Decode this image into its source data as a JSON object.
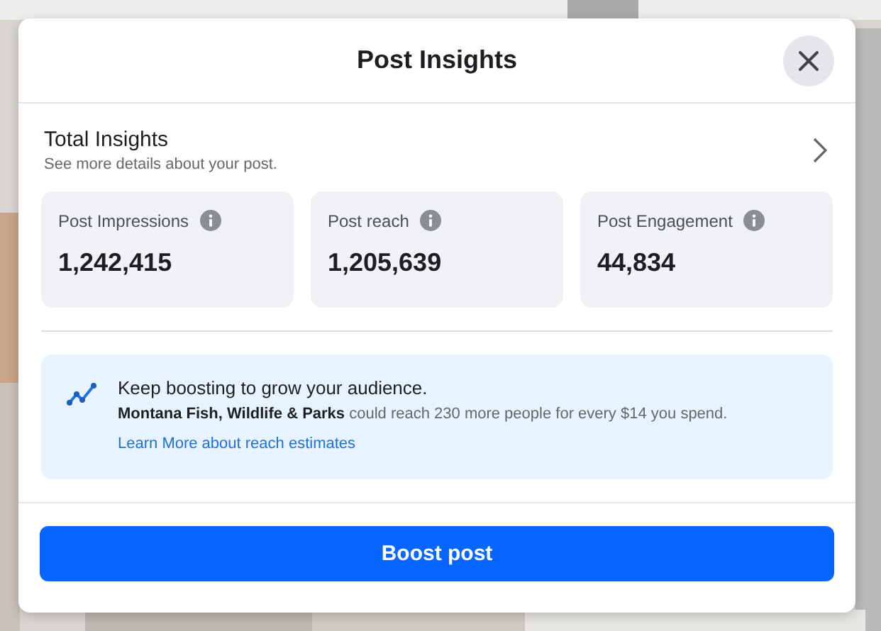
{
  "dialog": {
    "title": "Post Insights"
  },
  "summary": {
    "title": "Total Insights",
    "subtitle": "See more details about your post."
  },
  "metrics": [
    {
      "label": "Post Impressions",
      "value": "1,242,415"
    },
    {
      "label": "Post reach",
      "value": "1,205,639"
    },
    {
      "label": "Post Engagement",
      "value": "44,834"
    }
  ],
  "tip": {
    "heading": "Keep boosting to grow your audience.",
    "text": "**Montana Fish, Wildlife & Parks** could reach 230 more people for every $14 you spend.",
    "link": "Learn More about reach estimates"
  },
  "button": "Boost post"
}
